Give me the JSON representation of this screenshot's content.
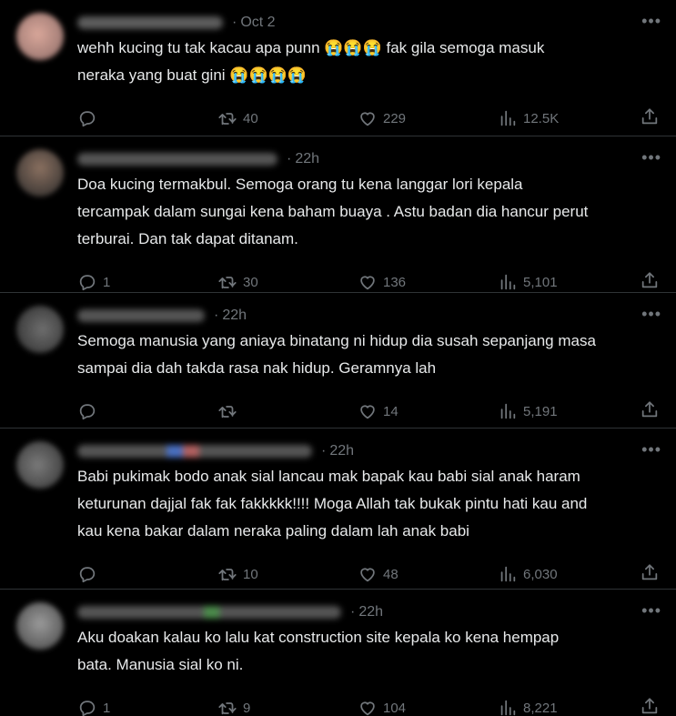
{
  "tweets": [
    {
      "time": "Oct 2",
      "lines": [
        "wehh kucing tu tak kacau apa punn 😭😭😭  fak gila semoga masuk",
        "neraka yang buat gini 😭😭😭😭"
      ],
      "replies": "",
      "retweets": "40",
      "likes": "229",
      "views": "12.5K"
    },
    {
      "time": "22h",
      "lines": [
        "Doa kucing termakbul. Semoga orang tu kena langgar lori kepala",
        "tercampak dalam sungai kena baham buaya . Astu badan dia hancur perut",
        "terburai. Dan tak dapat ditanam."
      ],
      "replies": "1",
      "retweets": "30",
      "likes": "136",
      "views": "5,101"
    },
    {
      "time": "22h",
      "lines": [
        "Semoga manusia yang aniaya binatang ni hidup dia susah sepanjang masa",
        "sampai dia dah takda rasa nak hidup. Geramnya lah"
      ],
      "replies": "",
      "retweets": "",
      "likes": "14",
      "views": "5,191"
    },
    {
      "time": "22h",
      "lines": [
        "Babi pukimak bodo anak sial lancau mak bapak kau babi sial anak haram",
        "keturunan dajjal fak fak fakkkkk!!!! Moga Allah tak bukak pintu hati kau and",
        "kau kena bakar dalam neraka paling dalam lah anak babi"
      ],
      "replies": "",
      "retweets": "10",
      "likes": "48",
      "views": "6,030"
    },
    {
      "time": "22h",
      "lines": [
        "Aku doakan kalau ko lalu kat construction site kepala ko kena hempap",
        "bata. Manusia sial ko ni."
      ],
      "replies": "1",
      "retweets": "9",
      "likes": "104",
      "views": "8,221"
    }
  ],
  "more_icon": "more-horizontal-icon",
  "colors": {
    "background": "#000000",
    "text": "#e7e9ea",
    "muted": "#71767b",
    "divider": "#2f3336"
  }
}
